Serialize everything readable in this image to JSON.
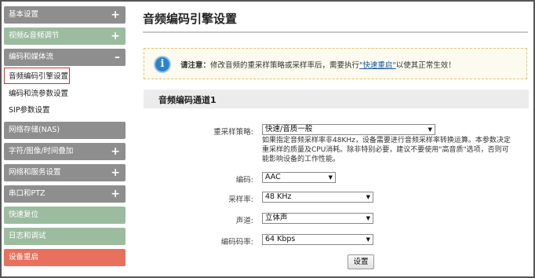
{
  "sidebar": {
    "items": [
      {
        "label": "基本设置",
        "sign": "+"
      },
      {
        "label": "视频&音频调节",
        "sign": "+"
      },
      {
        "label": "编码和媒体流",
        "sign": "–"
      },
      {
        "label": "网络存储(NAS)",
        "sign": "+"
      },
      {
        "label": "字符/图像/时间叠加",
        "sign": "+"
      },
      {
        "label": "网络和服务设置",
        "sign": "+"
      },
      {
        "label": "串口和PTZ",
        "sign": "+"
      },
      {
        "label": "快速复位",
        "sign": ""
      },
      {
        "label": "日志和调试",
        "sign": ""
      },
      {
        "label": "设备重启",
        "sign": ""
      }
    ],
    "subitems": [
      "音频编码引擎设置",
      "编码和流参数设置",
      "SIP参数设置"
    ]
  },
  "main": {
    "title": "音频编码引擎设置",
    "notice": {
      "prefix": "请注意：",
      "text": "修改音频的重采样策略或采样率后，需要执行",
      "link": "\"快速重启\"",
      "suffix": "以使其正常生效！"
    },
    "section_title": "音频编码通道1",
    "form": {
      "resample_label": "重采样策略:",
      "resample_value": "快速/音质一般",
      "resample_desc": "如果指定音频采样率非48KHz，设备需要进行音频采样率转换运算。本参数决定重采样的质量及CPU消耗。除非特别必要，建议不要使用\"高音质\"选项，否则可能影响设备的工作性能。",
      "codec_label": "编码:",
      "codec_value": "AAC",
      "samplerate_label": "采样率:",
      "samplerate_value": "48 KHz",
      "channel_label": "声道:",
      "channel_value": "立体声",
      "bitrate_label": "编码码率:",
      "bitrate_value": "64 Kbps",
      "submit_label": "设置"
    }
  },
  "colors": {
    "sidebar_gray": "#8e8e8e",
    "sidebar_green": "#9cbca0",
    "sidebar_red": "#e8705c",
    "active_border": "#d03030",
    "info_icon": "#2d82cc",
    "link": "#1a55a8"
  },
  "icons": {
    "notice": "info-icon",
    "dropdown": "dropdown-arrow-icon"
  }
}
